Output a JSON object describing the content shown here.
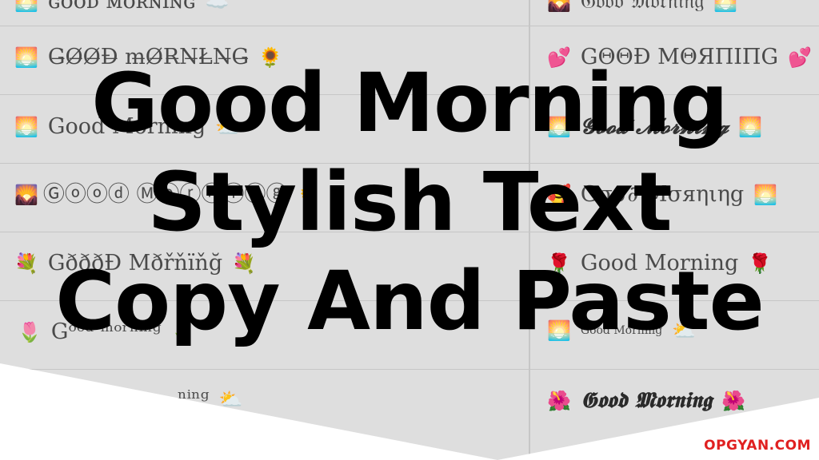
{
  "headline": {
    "line1": "Good Morning",
    "line2": "Stylish Text",
    "line3": "Copy And Paste"
  },
  "brand": "OPGYAN.COM",
  "colors": {
    "background": "#dedede",
    "headline": "#000000",
    "brand": "#e02020"
  },
  "table": {
    "left": [
      {
        "lead": "🌅",
        "text": "ɢᴏᴏᴅ ᴍᴏʀɴɪɴɢ",
        "trail": "☁️"
      },
      {
        "lead": "🌅",
        "text": "G̶Ø̶Ø̶Đ̶ m̶Ø̶R̶N̶Ł̶N̶G̶",
        "trail": "🌻"
      },
      {
        "lead": "🌅",
        "text": "Good Morning",
        "trail": "⛅"
      },
      {
        "lead": "🌄",
        "text": "Ⓖⓞⓞⓓ Ⓜⓞⓡⓝⓘⓝⓖ",
        "trail": "🌻"
      },
      {
        "lead": "💐",
        "text": "GðððĐ Mðřňïňğ",
        "trail": "💐"
      },
      {
        "lead": "🌷",
        "text": "Gᵒᵒᵈ ᵐᵒʳⁿⁱⁿᵍ",
        "trail": "🌷"
      },
      {
        "lead": "",
        "text": "ⁿⁱⁿᵍ",
        "trail": "⛅"
      }
    ],
    "right": [
      {
        "lead": "🌄",
        "text": "𝔊𝔬𝔬𝔡 𝔐𝔬𝔯𝔫𝔦𝔫𝔤",
        "trail": "🌅"
      },
      {
        "lead": "💕",
        "text": "GΘΘĐ MΘЯПIПG",
        "trail": "💕"
      },
      {
        "lead": "🌅",
        "text": "𝓖𝓸𝓸𝓭 𝓜𝓸𝓻𝓷𝓲𝓷𝓰",
        "trail": "🌅"
      },
      {
        "lead": "🥰",
        "text": "Gσσ∂ Mσяηιηg",
        "trail": "🌅"
      },
      {
        "lead": "🌹",
        "text": "Good Morning",
        "trail": "🌹"
      },
      {
        "lead": "🌅",
        "text": "Good Morning",
        "trail": "⛅"
      },
      {
        "lead": "🌺",
        "text": "𝕲𝖔𝖔𝖉 𝕸𝖔𝖗𝖓𝖎𝖓𝖌",
        "trail": "🌺"
      }
    ]
  }
}
